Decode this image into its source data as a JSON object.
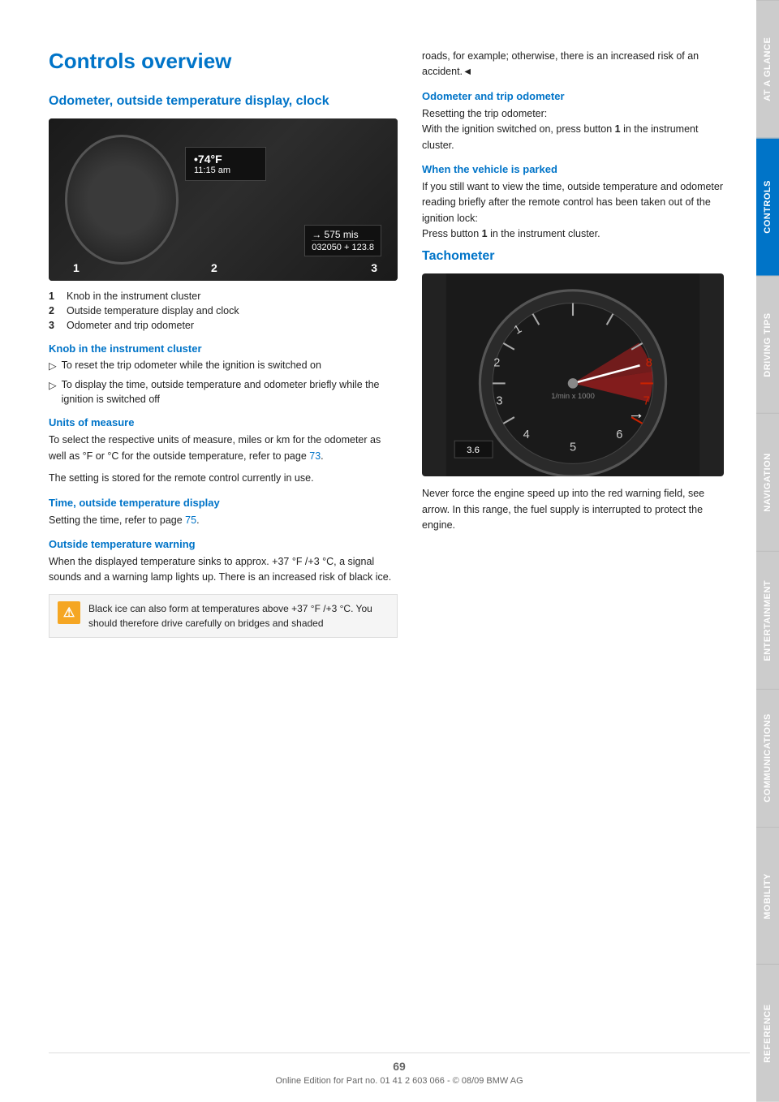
{
  "page": {
    "title": "Controls overview",
    "number": "69",
    "footer": "Online Edition for Part no. 01 41 2 603 066 - © 08/09 BMW AG"
  },
  "sidebar": {
    "tabs": [
      {
        "label": "At a glance",
        "active": false
      },
      {
        "label": "Controls",
        "active": true
      },
      {
        "label": "Driving tips",
        "active": false
      },
      {
        "label": "Navigation",
        "active": false
      },
      {
        "label": "Entertainment",
        "active": false
      },
      {
        "label": "Communications",
        "active": false
      },
      {
        "label": "Mobility",
        "active": false
      },
      {
        "label": "Reference",
        "active": false
      }
    ]
  },
  "left_section": {
    "heading": "Odometer, outside temperature display, clock",
    "image": {
      "temp": "•74°F",
      "time": "11:15 am",
      "odo_top": "→  575 mis",
      "odo_bottom": "032050 + 123.8",
      "labels": [
        "1",
        "2",
        "3"
      ]
    },
    "numbered_items": [
      {
        "num": "1",
        "text": "Knob in the instrument cluster"
      },
      {
        "num": "2",
        "text": "Outside temperature display and clock"
      },
      {
        "num": "3",
        "text": "Odometer and trip odometer"
      }
    ],
    "knob_section": {
      "heading": "Knob in the instrument cluster",
      "items": [
        "To reset the trip odometer while the ignition is switched on",
        "To display the time, outside temperature and odometer briefly while the ignition is switched off"
      ]
    },
    "units_section": {
      "heading": "Units of measure",
      "text1": "To select the respective units of measure, miles or km for the odometer as well as  °F  or  °C for the outside temperature, refer to page 73.",
      "text2": "The setting is stored for the remote control currently in use."
    },
    "time_section": {
      "heading": "Time, outside temperature display",
      "text": "Setting the time, refer to page 75."
    },
    "warning_section": {
      "heading": "Outside temperature warning",
      "text": "When the displayed temperature sinks to approx. +37 °F /+3 °C, a signal sounds and a warning lamp lights up. There is an increased risk of black ice.",
      "warning_box": "Black ice can also form at temperatures above +37 °F /+3 °C. You should therefore drive carefully on bridges and shaded"
    }
  },
  "right_section": {
    "continued_text": "roads, for example; otherwise, there is an increased risk of an accident.◄",
    "odometer_section": {
      "heading": "Odometer and trip odometer",
      "text": "Resetting the trip odometer: With the ignition switched on, press button 1 in the instrument cluster."
    },
    "parked_section": {
      "heading": "When the vehicle is parked",
      "text": "If you still want to view the time, outside temperature and odometer reading briefly after the remote control has been taken out of the ignition lock: Press button 1 in the instrument cluster."
    },
    "tachometer_section": {
      "heading": "Tachometer",
      "caption": "Never force the engine speed up into the red warning field, see arrow. In this range, the fuel supply is interrupted to protect the engine."
    }
  }
}
